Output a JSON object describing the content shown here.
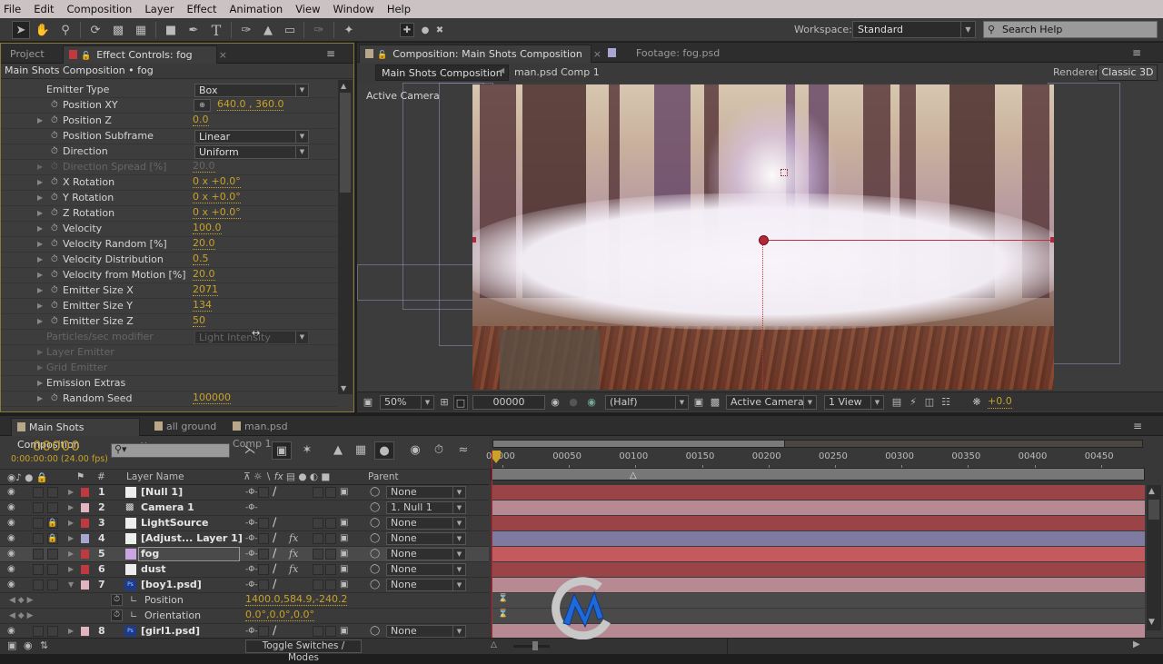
{
  "menu": [
    "File",
    "Edit",
    "Composition",
    "Layer",
    "Effect",
    "Animation",
    "View",
    "Window",
    "Help"
  ],
  "toolbar": {
    "tools": [
      "selection-tool",
      "hand-tool",
      "zoom-tool",
      "rotation-tool",
      "camera-tool",
      "pan-behind-tool",
      "rectangle-tool",
      "pen-tool",
      "text-tool",
      "brush-tool",
      "clone-stamp-tool",
      "eraser-tool",
      "roto-brush-tool",
      "puppet-pin-tool"
    ],
    "axis_tools": [
      "local-axis-mode",
      "world-axis-mode",
      "view-axis-mode"
    ],
    "workspace_label": "Workspace:",
    "workspace_value": "Standard",
    "search_placeholder": "Search Help"
  },
  "effect_panel": {
    "tab_project": "Project",
    "tab_effect": "Effect Controls: fog",
    "subheader": "Main Shots Composition • fog",
    "rows": [
      {
        "label": "Emitter Type",
        "type": "dropdown",
        "value": "Box",
        "twirl": false,
        "stopwatch": false,
        "dim": false
      },
      {
        "label": "Position XY",
        "type": "point",
        "value": "640.0 , 360.0",
        "twirl": false,
        "stopwatch": true,
        "dim": false
      },
      {
        "label": "Position Z",
        "type": "value",
        "value": "0.0",
        "twirl": true,
        "stopwatch": true,
        "dim": false
      },
      {
        "label": "Position Subframe",
        "type": "dropdown",
        "value": "Linear",
        "twirl": false,
        "stopwatch": true,
        "dim": false
      },
      {
        "label": "Direction",
        "type": "dropdown",
        "value": "Uniform",
        "twirl": false,
        "stopwatch": true,
        "dim": false
      },
      {
        "label": "Direction Spread [%]",
        "type": "value",
        "value": "20.0",
        "twirl": true,
        "stopwatch": true,
        "dim": true
      },
      {
        "label": "X Rotation",
        "type": "value",
        "value": "0 x +0.0°",
        "twirl": true,
        "stopwatch": true,
        "dim": false
      },
      {
        "label": "Y Rotation",
        "type": "value",
        "value": "0 x +0.0°",
        "twirl": true,
        "stopwatch": true,
        "dim": false
      },
      {
        "label": "Z Rotation",
        "type": "value",
        "value": "0 x +0.0°",
        "twirl": true,
        "stopwatch": true,
        "dim": false
      },
      {
        "label": "Velocity",
        "type": "value",
        "value": "100.0",
        "twirl": true,
        "stopwatch": true,
        "dim": false
      },
      {
        "label": "Velocity Random [%]",
        "type": "value",
        "value": "20.0",
        "twirl": true,
        "stopwatch": true,
        "dim": false
      },
      {
        "label": "Velocity Distribution",
        "type": "value",
        "value": "0.5",
        "twirl": true,
        "stopwatch": true,
        "dim": false
      },
      {
        "label": "Velocity from Motion [%]",
        "type": "value",
        "value": "20.0",
        "twirl": true,
        "stopwatch": true,
        "dim": false
      },
      {
        "label": "Emitter Size X",
        "type": "value",
        "value": "2071",
        "twirl": true,
        "stopwatch": true,
        "dim": false
      },
      {
        "label": "Emitter Size Y",
        "type": "value",
        "value": "134",
        "twirl": true,
        "stopwatch": true,
        "dim": false
      },
      {
        "label": "Emitter Size Z",
        "type": "value",
        "value": "50",
        "twirl": true,
        "stopwatch": true,
        "dim": false
      },
      {
        "label": "Particles/sec modifier",
        "type": "dropdown",
        "value": "Light Intensity",
        "twirl": false,
        "stopwatch": false,
        "dim": true
      },
      {
        "label": "Layer Emitter",
        "type": "group",
        "value": "",
        "twirl": true,
        "stopwatch": false,
        "dim": true
      },
      {
        "label": "Grid Emitter",
        "type": "group",
        "value": "",
        "twirl": true,
        "stopwatch": false,
        "dim": true
      },
      {
        "label": "Emission Extras",
        "type": "group",
        "value": "",
        "twirl": true,
        "stopwatch": false,
        "dim": false
      },
      {
        "label": "Random Seed",
        "type": "value",
        "value": "100000",
        "twirl": true,
        "stopwatch": true,
        "dim": false
      }
    ]
  },
  "comp_panel": {
    "tab_comp": "Composition: Main Shots Composition",
    "tab_footage": "Footage: fog.psd",
    "breadcrumb": [
      "Main Shots Composition",
      "man.psd Comp 1"
    ],
    "renderer_label": "Renderer:",
    "renderer_value": "Classic 3D",
    "view_label": "Active Camera",
    "viewer_bar": {
      "zoom": "50%",
      "timecode": "00000",
      "resolution": "(Half)",
      "camera": "Active Camera",
      "views": "1 View",
      "exposure": "+0.0"
    }
  },
  "timeline": {
    "tabs": [
      "Main Shots Composition",
      "all ground",
      "man.psd Comp 1"
    ],
    "timecode": "00000",
    "timecode_sub": "0:00:00:00 (24.00 fps)",
    "columns": {
      "number": "#",
      "layer_name": "Layer Name",
      "parent": "Parent"
    },
    "ruler_ticks": [
      "00000",
      "00050",
      "00100",
      "00150",
      "00200",
      "00250",
      "00300",
      "00350",
      "00400",
      "00450"
    ],
    "work_area_end_fraction": 0.45,
    "layers": [
      {
        "num": "1",
        "name": "[Null 1]",
        "label_color": "#c0393f",
        "track_color": "#9b4448",
        "icon": "solid",
        "locked": false,
        "fx": false,
        "parent": "None",
        "twirl": "closed",
        "selected": false
      },
      {
        "num": "2",
        "name": "Camera 1",
        "label_color": "#e2b4c0",
        "track_color": "#b68993",
        "icon": "camera",
        "locked": false,
        "fx": false,
        "parent": "1. Null 1",
        "twirl": "closed",
        "selected": false
      },
      {
        "num": "3",
        "name": "LightSource",
        "label_color": "#c0393f",
        "track_color": "#9b4448",
        "icon": "solid",
        "locked": true,
        "fx": false,
        "parent": "None",
        "twirl": "closed",
        "selected": false
      },
      {
        "num": "4",
        "name": "[Adjust... Layer 1]",
        "label_color": "#a6a6d0",
        "track_color": "#7e7aa0",
        "icon": "solid",
        "locked": true,
        "fx": true,
        "parent": "None",
        "twirl": "closed",
        "selected": false
      },
      {
        "num": "5",
        "name": "fog",
        "label_color": "#c0393f",
        "track_color": "#c25a5e",
        "icon": "purple",
        "locked": false,
        "fx": true,
        "parent": "None",
        "twirl": "closed",
        "selected": true
      },
      {
        "num": "6",
        "name": "dust",
        "label_color": "#c0393f",
        "track_color": "#9b4448",
        "icon": "solid",
        "locked": false,
        "fx": true,
        "parent": "None",
        "twirl": "closed",
        "selected": false
      },
      {
        "num": "7",
        "name": "[boy1.psd]",
        "label_color": "#e2b4c0",
        "track_color": "#b68993",
        "icon": "psd",
        "locked": false,
        "fx": false,
        "parent": "None",
        "twirl": "open",
        "selected": false
      }
    ],
    "properties": [
      {
        "name": "Position",
        "value": "1400.0,584.9,-240.2"
      },
      {
        "name": "Orientation",
        "value": "0.0°,0.0°,0.0°"
      }
    ],
    "last_layer": {
      "num": "8",
      "name": "[girl1.psd]",
      "label_color": "#e2b4c0",
      "track_color": "#b68993",
      "parent": "None"
    },
    "toggle_label": "Toggle Switches / Modes"
  }
}
